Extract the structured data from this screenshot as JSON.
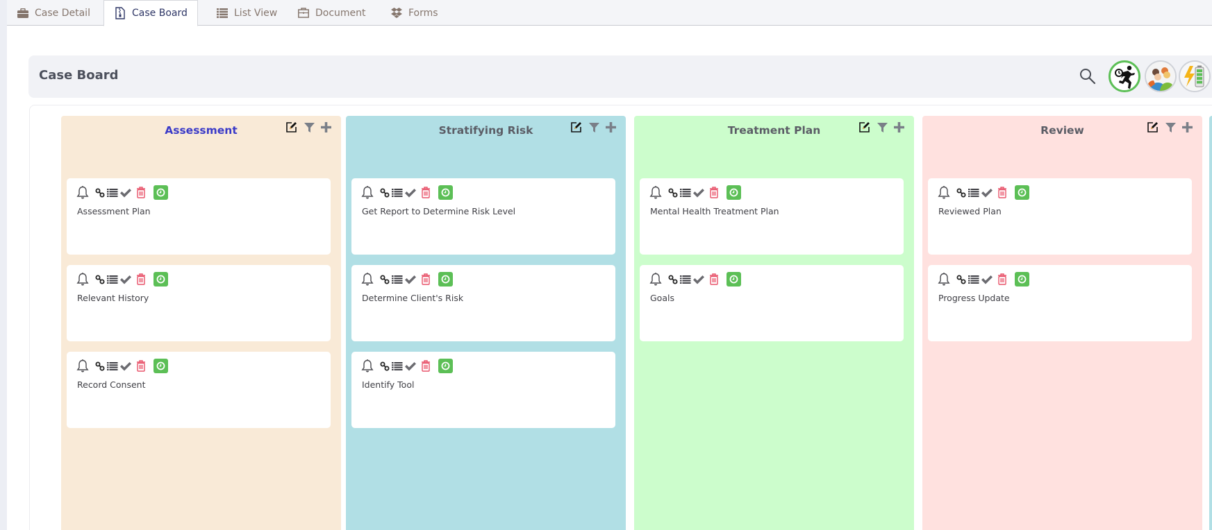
{
  "tabs": [
    {
      "label": "Case Detail",
      "icon": "briefcase-icon",
      "active": false
    },
    {
      "label": "Case Board",
      "icon": "file-zip-icon",
      "active": true
    },
    {
      "label": "List View",
      "icon": "list-icon",
      "active": false
    },
    {
      "label": "Document",
      "icon": "document-case-icon",
      "active": false
    },
    {
      "label": "Forms",
      "icon": "dropbox-icon",
      "active": false
    }
  ],
  "header": {
    "title": "Case Board",
    "search_icon": "search-icon",
    "avatars": [
      {
        "name": "runner-timer-avatar",
        "ring_color": "#5cbf56"
      },
      {
        "name": "team-avatar"
      },
      {
        "name": "battery-charge-avatar"
      }
    ]
  },
  "colors": {
    "assessment": "#f9ead7",
    "stratifying": "#b1dfe5",
    "treatment": "#ccfdcc",
    "review": "#ffe1df",
    "trash": "#e8536a",
    "clock_badge": "#5cbf56",
    "icon_gray": "#6b6b70",
    "active_title": "#3a3ac8"
  },
  "columns": [
    {
      "title": "Assessment",
      "highlight": true,
      "cards": [
        {
          "title": "Assessment Plan"
        },
        {
          "title": "Relevant History"
        },
        {
          "title": "Record Consent"
        }
      ]
    },
    {
      "title": "Stratifying Risk",
      "highlight": false,
      "cards": [
        {
          "title": "Get Report to Determine Risk Level"
        },
        {
          "title": "Determine Client's Risk"
        },
        {
          "title": "Identify Tool"
        }
      ]
    },
    {
      "title": "Treatment Plan",
      "highlight": false,
      "cards": [
        {
          "title": "Mental Health Treatment Plan"
        },
        {
          "title": "Goals"
        }
      ]
    },
    {
      "title": "Review",
      "highlight": false,
      "cards": [
        {
          "title": "Reviewed Plan"
        },
        {
          "title": "Progress Update"
        }
      ]
    }
  ]
}
